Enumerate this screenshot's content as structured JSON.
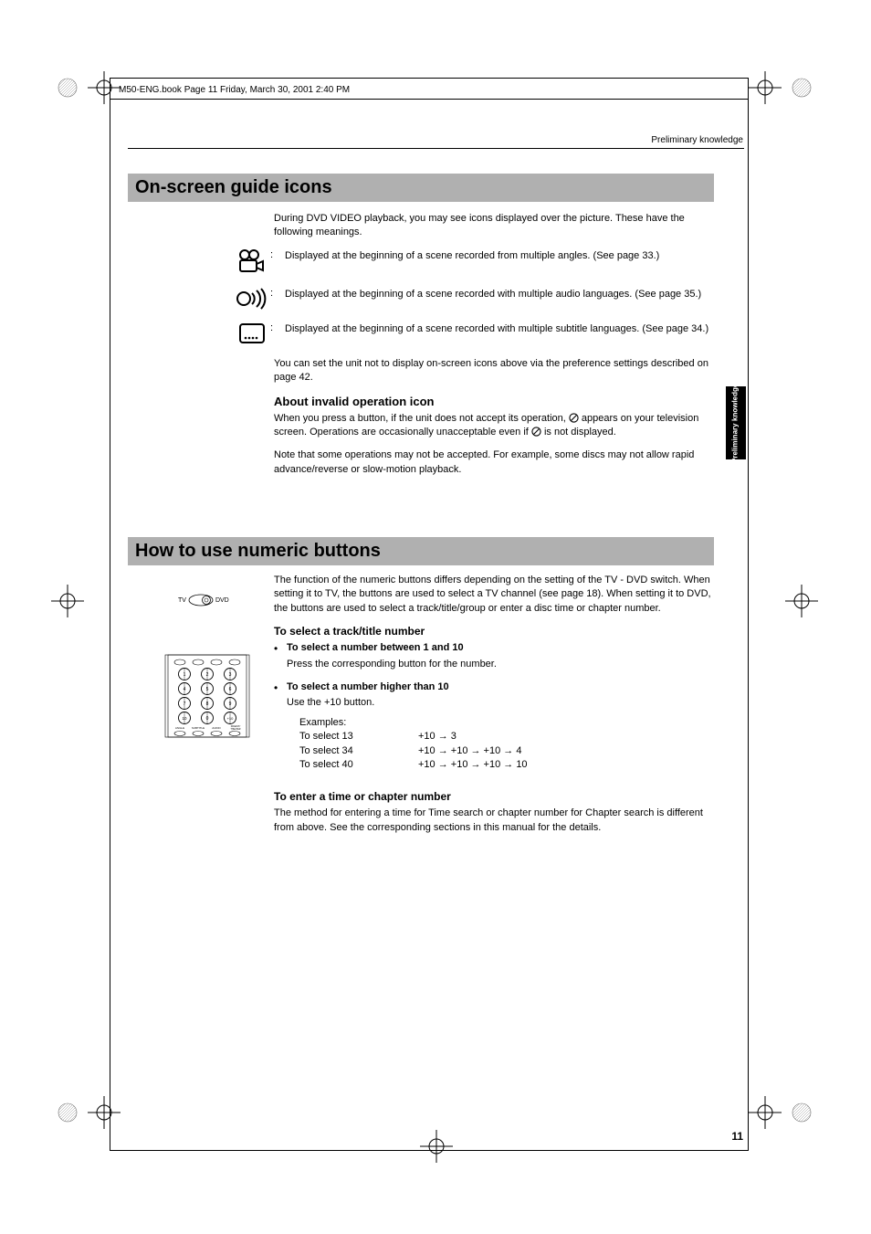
{
  "book_header": "M50-ENG.book  Page 11  Friday, March 30, 2001  2:40 PM",
  "page_header_right": "Preliminary knowledge",
  "side_tab_line1": "Preliminary",
  "side_tab_line2": "knowledge",
  "page_number": "11",
  "section1": {
    "title": "On-screen guide icons",
    "intro": "During DVD VIDEO playback, you may see icons displayed over the picture.  These have the following meanings.",
    "icon_rows": [
      {
        "desc": "Displayed at the beginning of a scene recorded from multiple angles. (See page 33.)"
      },
      {
        "desc": "Displayed at the beginning of a scene recorded with multiple audio languages. (See page 35.)"
      },
      {
        "desc": "Displayed at the beginning of a scene recorded with multiple subtitle languages.  (See page 34.)"
      }
    ],
    "pref_note": "You can set the unit not to display on-screen icons above via the preference settings described on page 42.",
    "invalid_heading": "About invalid operation icon",
    "invalid_p1a": "When you press a button, if the unit does not accept its operation, ",
    "invalid_p1b": " appears on your television screen. Operations are occasionally unacceptable even if ",
    "invalid_p1c": " is not displayed.",
    "invalid_p2": "Note that some operations may not be accepted. For example, some discs may not allow rapid advance/reverse or slow-motion playback."
  },
  "section2": {
    "title": "How to use numeric buttons",
    "intro": "The function of the numeric buttons differs depending on the setting of the TV - DVD switch. When setting it to TV, the buttons are used to select a TV channel (see page 18). When setting it to DVD, the buttons are used to select a track/title/group or enter a disc time or chapter number.",
    "sub1_heading": "To select a track/title number",
    "bullet1_strong": "To select a number between 1 and 10",
    "bullet1_sub": "Press the corresponding button for the number.",
    "bullet2_strong": "To select a number higher than 10",
    "bullet2_sub": "Use the +10 button.",
    "examples_label": "Examples:",
    "examples": [
      {
        "label": "To select 13",
        "seq": "+10 → 3"
      },
      {
        "label": "To select 34",
        "seq": "+10 → +10 → +10 → 4"
      },
      {
        "label": "To select 40",
        "seq": "+10 → +10 → +10 → 10"
      }
    ],
    "sub2_heading": "To enter a time or chapter number",
    "sub2_para": "The method for entering a time for Time search or chapter number for Chapter search is different from above. See the corresponding sections in this manual for the details."
  },
  "tv_label": "TV",
  "dvd_label": "DVD",
  "keypad_labels": [
    "1",
    "2",
    "3",
    "4",
    "5",
    "6",
    "7",
    "8",
    "9",
    "10",
    "0",
    "+10"
  ],
  "keypad_bottom": [
    "ANGLE",
    "SUBTITLE",
    "AUDIO",
    "DIGEST/THEATER POSITION"
  ]
}
